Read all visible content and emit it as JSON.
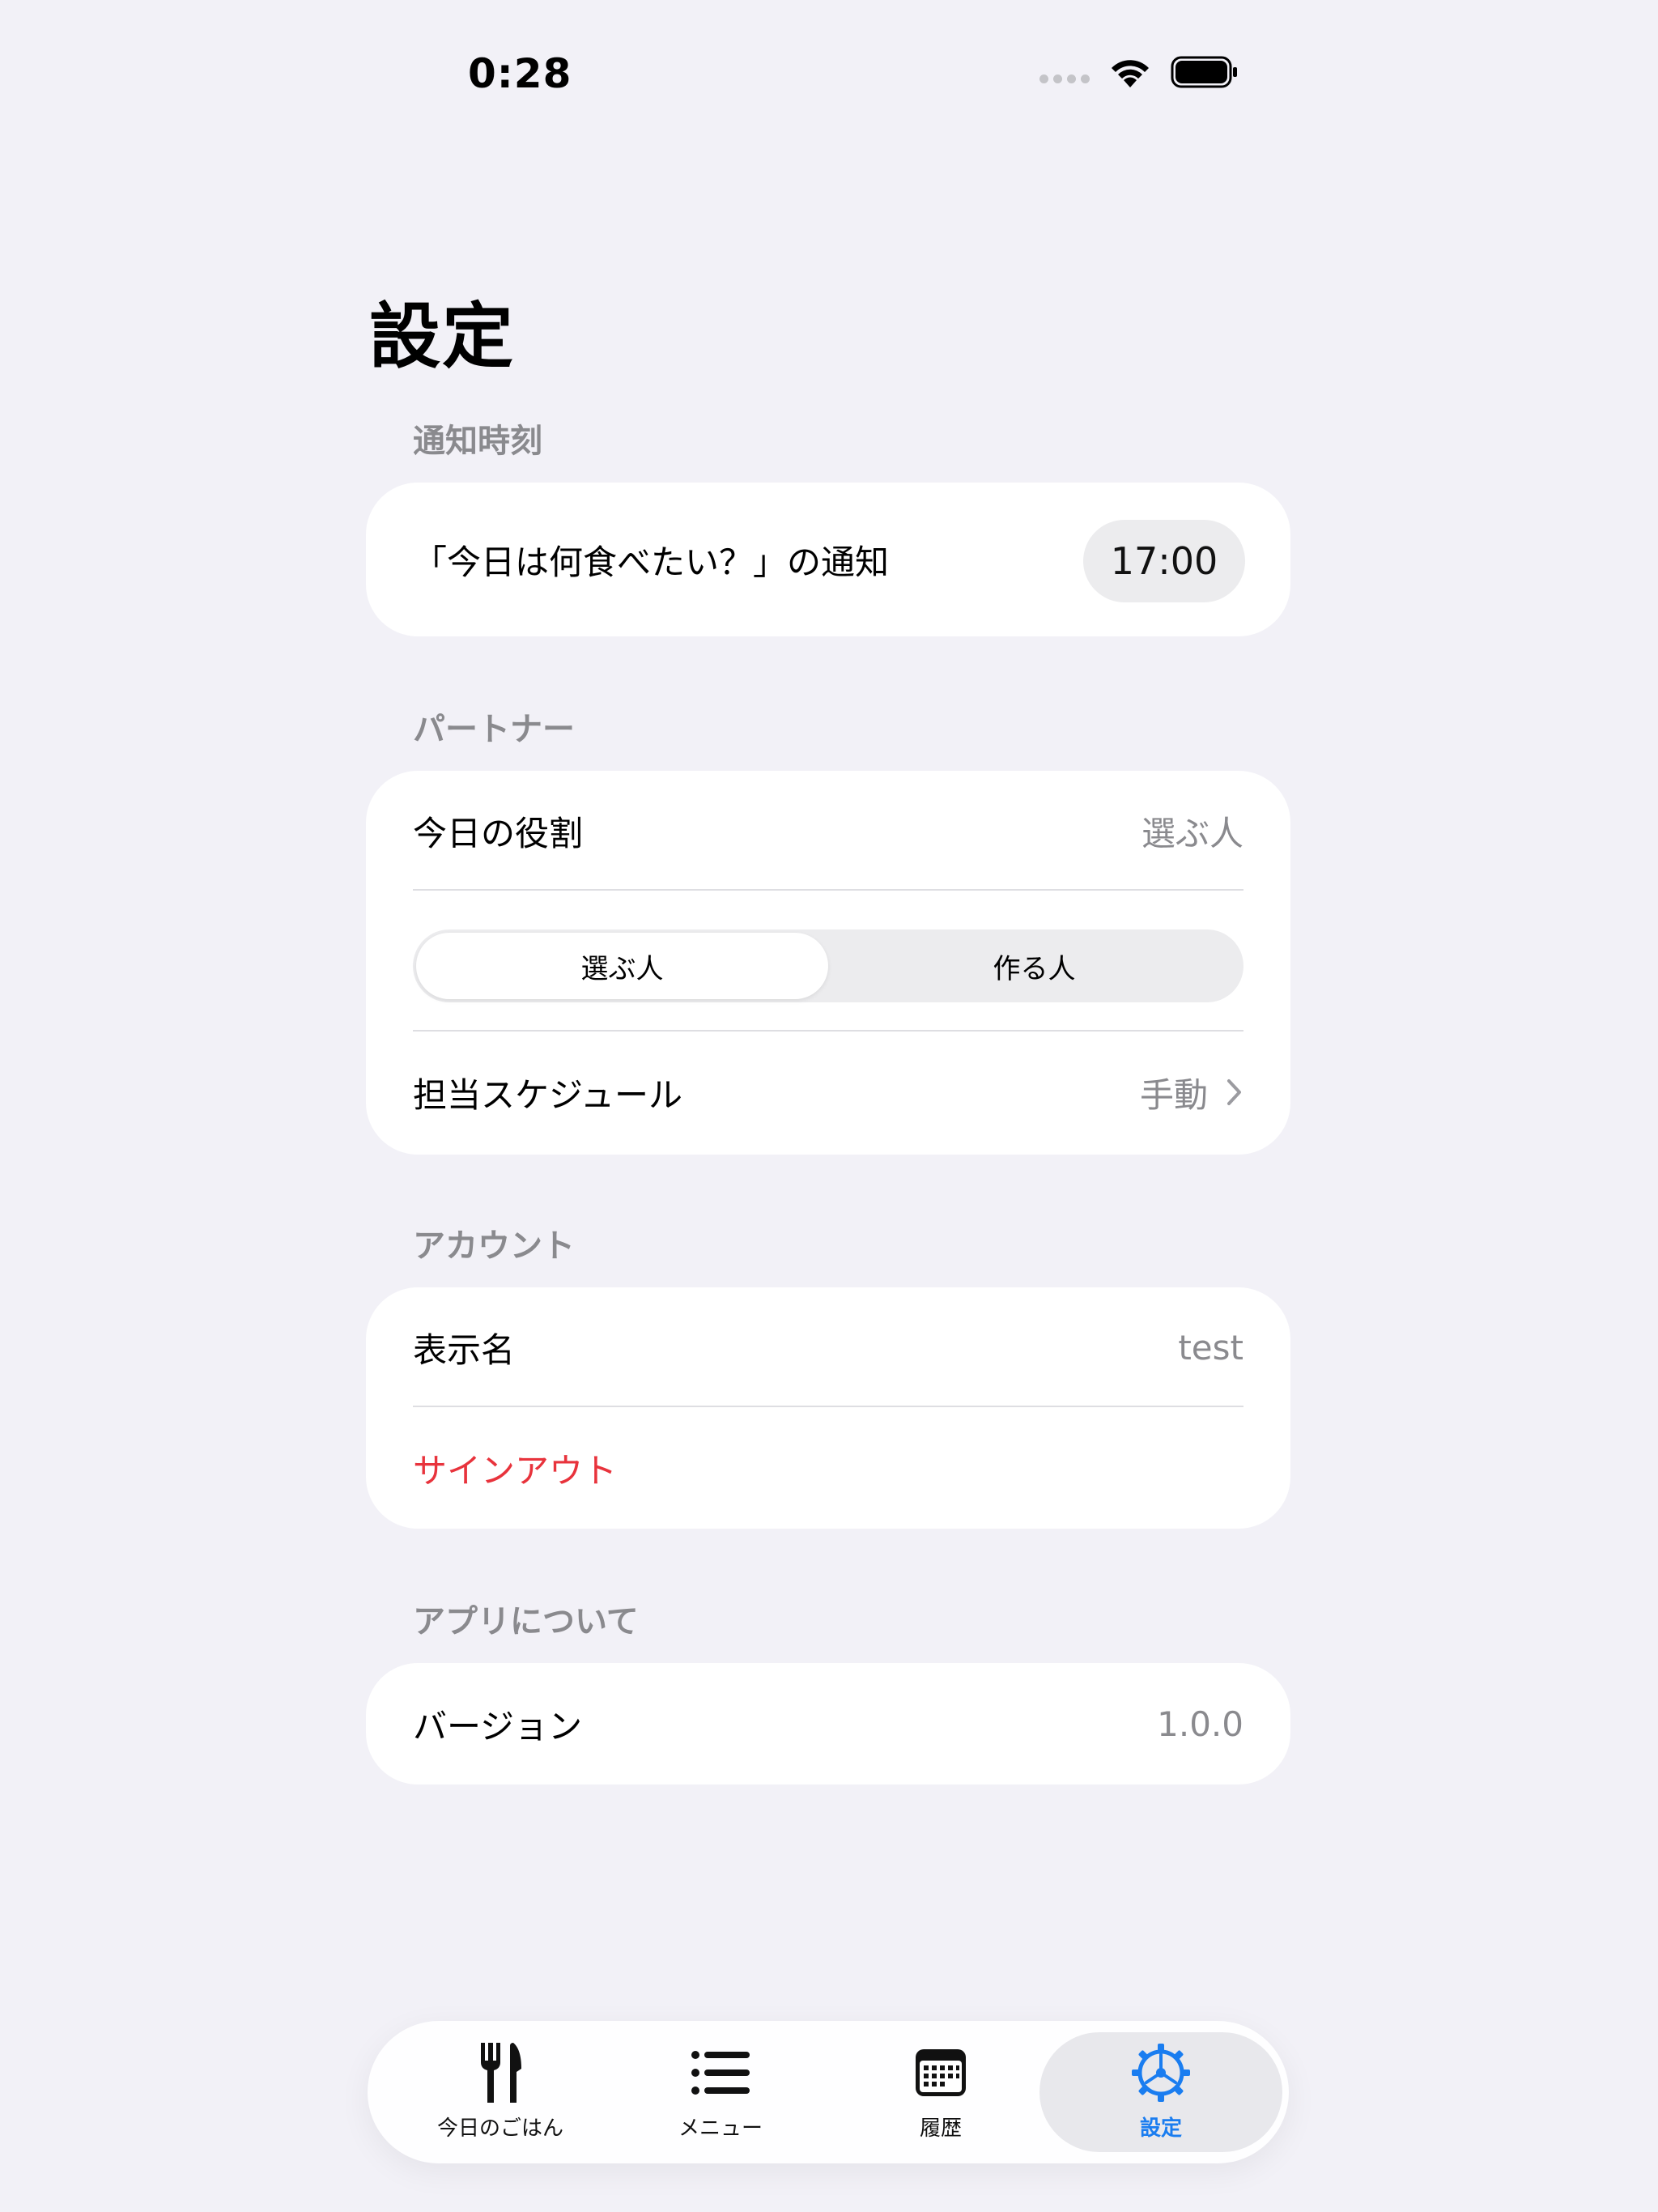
{
  "status_bar": {
    "time": "0:28"
  },
  "page_title": "設定",
  "sections": {
    "notification": {
      "header": "通知時刻",
      "row_label": "「今日は何食べたい？」の通知",
      "time_value": "17:00"
    },
    "partner": {
      "header": "パートナー",
      "role_label": "今日の役割",
      "role_value": "選ぶ人",
      "segments": [
        "選ぶ人",
        "作る人"
      ],
      "selected_segment": "選ぶ人",
      "schedule_label": "担当スケジュール",
      "schedule_value": "手動"
    },
    "account": {
      "header": "アカウント",
      "display_name_label": "表示名",
      "display_name_value": "test",
      "signout_label": "サインアウト"
    },
    "about": {
      "header": "アプリについて",
      "version_label": "バージョン",
      "version_value": "1.0.0"
    }
  },
  "tabbar": {
    "tabs": [
      {
        "label": "今日のごはん",
        "icon": "fork-knife-icon"
      },
      {
        "label": "メニュー",
        "icon": "list-icon"
      },
      {
        "label": "履歴",
        "icon": "calendar-icon"
      },
      {
        "label": "設定",
        "icon": "gear-icon"
      }
    ],
    "active": "設定"
  },
  "colors": {
    "background": "#f2f1f7",
    "accent": "#1a7df0",
    "destructive": "#e8333c",
    "secondary_text": "#8a8a8e"
  }
}
